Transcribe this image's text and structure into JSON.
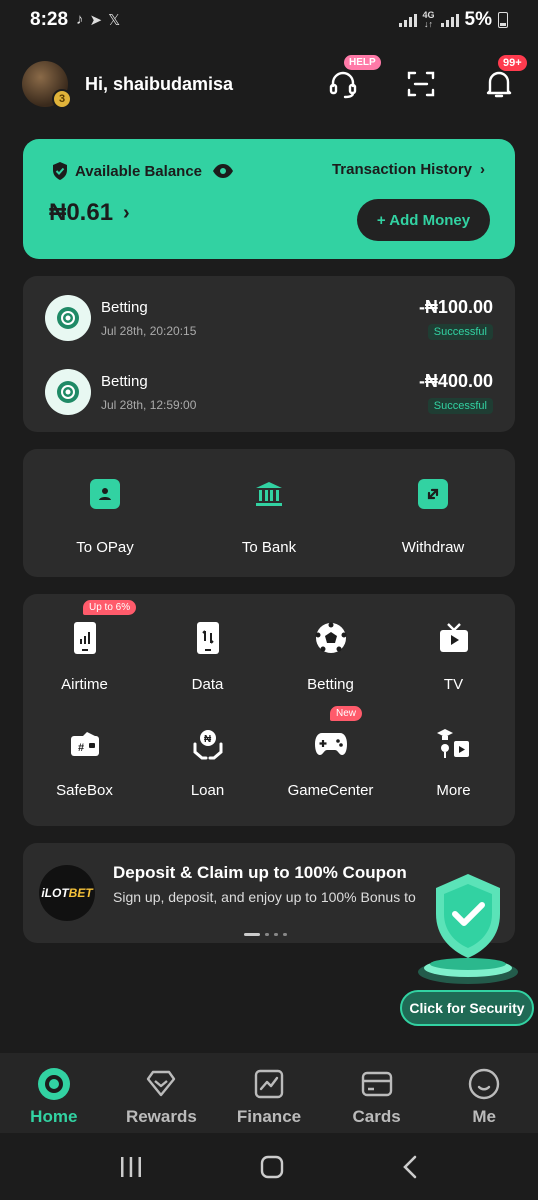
{
  "status_bar": {
    "time": "8:28",
    "battery": "5%"
  },
  "header": {
    "greeting": "Hi, shaibudamisa",
    "avatar_level": "3",
    "help_tag": "HELP",
    "notification_count": "99+"
  },
  "balance": {
    "label": "Available Balance",
    "amount": "₦0.61",
    "history_link": "Transaction History",
    "add_money": "+ Add Money"
  },
  "transactions": [
    {
      "title": "Betting",
      "date": "Jul 28th, 20:20:15",
      "amount": "-₦100.00",
      "status": "Successful"
    },
    {
      "title": "Betting",
      "date": "Jul 28th, 12:59:00",
      "amount": "-₦400.00",
      "status": "Successful"
    }
  ],
  "transfers": [
    {
      "label": "To OPay",
      "icon": "person-card-icon"
    },
    {
      "label": "To Bank",
      "icon": "bank-icon"
    },
    {
      "label": "Withdraw",
      "icon": "withdraw-icon"
    }
  ],
  "services": [
    {
      "label": "Airtime",
      "icon": "phone-airtime-icon",
      "tag": "Up to 6%"
    },
    {
      "label": "Data",
      "icon": "phone-data-icon",
      "tag": ""
    },
    {
      "label": "Betting",
      "icon": "soccer-ball-icon",
      "tag": ""
    },
    {
      "label": "TV",
      "icon": "tv-icon",
      "tag": ""
    },
    {
      "label": "SafeBox",
      "icon": "safebox-icon",
      "tag": ""
    },
    {
      "label": "Loan",
      "icon": "loan-hands-icon",
      "tag": ""
    },
    {
      "label": "GameCenter",
      "icon": "gamepad-icon",
      "tag": "New"
    },
    {
      "label": "More",
      "icon": "more-services-icon",
      "tag": ""
    }
  ],
  "promo": {
    "logo_text_a": "iLOT",
    "logo_text_b": "BET",
    "title": "Deposit & Claim up to 100% Coupon",
    "subtitle": "Sign up, deposit, and enjoy up to 100% Bonus to"
  },
  "security": {
    "button": "Click for Security"
  },
  "bottom_nav": [
    {
      "label": "Home",
      "icon": "home-icon",
      "active": true
    },
    {
      "label": "Rewards",
      "icon": "rewards-icon",
      "active": false
    },
    {
      "label": "Finance",
      "icon": "finance-icon",
      "active": false
    },
    {
      "label": "Cards",
      "icon": "card-icon",
      "active": false
    },
    {
      "label": "Me",
      "icon": "me-icon",
      "active": false
    }
  ],
  "colors": {
    "accent": "#32d2a2",
    "background": "#1c1c1c",
    "card": "#2c2c2c",
    "badge_red": "#ff3b4e"
  }
}
